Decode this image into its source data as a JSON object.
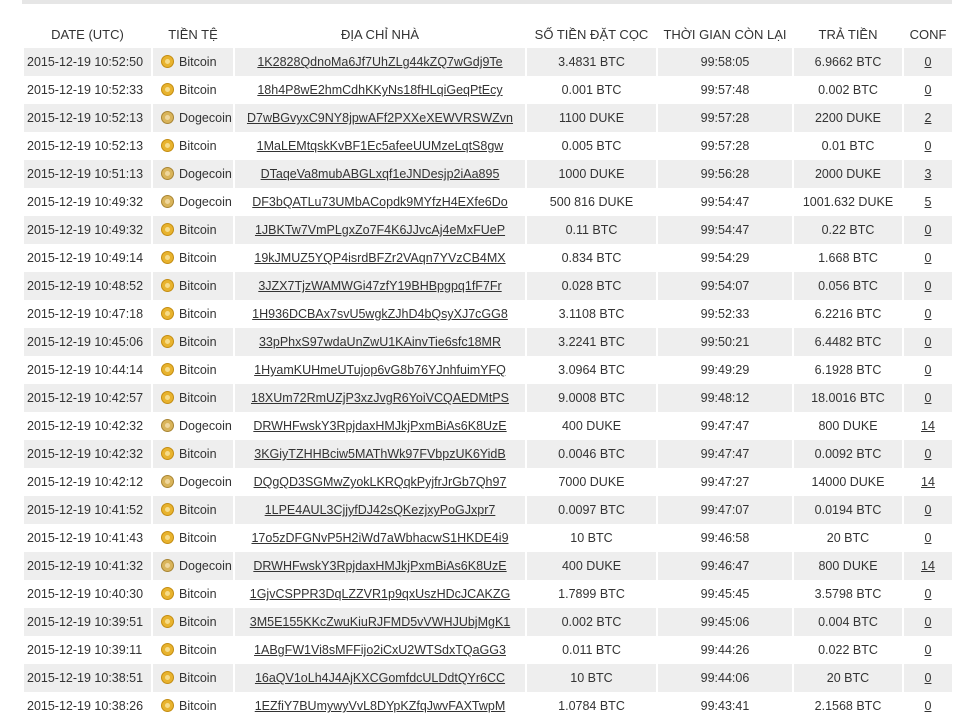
{
  "headers": {
    "date": "DATE (UTC)",
    "currency": "TIỀN TỆ",
    "address": "ĐỊA CHỈ NHÀ",
    "deposit": "SỐ TIỀN ĐẶT CỌC",
    "time_left": "THỜI GIAN CÒN LẠI",
    "payout": "TRẢ TIỀN",
    "conf": "CONF"
  },
  "icons": {
    "bitcoin": "bitcoin-coin-icon",
    "dogecoin": "dogecoin-coin-icon"
  },
  "rows": [
    {
      "date": "2015-12-19 10:52:50",
      "currency": "Bitcoin",
      "address": "1K2828QdnoMa6Jf7UhZLg44kZQ7wGdj9Te",
      "deposit": "3.4831 BTC",
      "time_left": "99:58:05",
      "payout": "6.9662 BTC",
      "conf": "0"
    },
    {
      "date": "2015-12-19 10:52:33",
      "currency": "Bitcoin",
      "address": "18h4P8wE2hmCdhKKyNs18fHLqiGeqPtEcy",
      "deposit": "0.001 BTC",
      "time_left": "99:57:48",
      "payout": "0.002 BTC",
      "conf": "0"
    },
    {
      "date": "2015-12-19 10:52:13",
      "currency": "Dogecoin",
      "address": "D7wBGvyxC9NY8jpwAFf2PXXeXEWVRSWZvn",
      "deposit": "1100 DUKE",
      "time_left": "99:57:28",
      "payout": "2200 DUKE",
      "conf": "2"
    },
    {
      "date": "2015-12-19 10:52:13",
      "currency": "Bitcoin",
      "address": "1MaLEMtqskKvBF1Ec5afeeUUMzeLqtS8gw",
      "deposit": "0.005 BTC",
      "time_left": "99:57:28",
      "payout": "0.01 BTC",
      "conf": "0"
    },
    {
      "date": "2015-12-19 10:51:13",
      "currency": "Dogecoin",
      "address": "DTaqeVa8mubABGLxqf1eJNDesjp2iAa895",
      "deposit": "1000 DUKE",
      "time_left": "99:56:28",
      "payout": "2000 DUKE",
      "conf": "3"
    },
    {
      "date": "2015-12-19 10:49:32",
      "currency": "Dogecoin",
      "address": "DF3bQATLu73UMbACopdk9MYfzH4EXfe6Do",
      "deposit": "500 816 DUKE",
      "time_left": "99:54:47",
      "payout": "1001.632 DUKE",
      "conf": "5"
    },
    {
      "date": "2015-12-19 10:49:32",
      "currency": "Bitcoin",
      "address": "1JBKTw7VmPLgxZo7F4K6JJvcAj4eMxFUeP",
      "deposit": "0.11 BTC",
      "time_left": "99:54:47",
      "payout": "0.22 BTC",
      "conf": "0"
    },
    {
      "date": "2015-12-19 10:49:14",
      "currency": "Bitcoin",
      "address": "19kJMUZ5YQP4isrdBFZr2VAqn7YVzCB4MX",
      "deposit": "0.834 BTC",
      "time_left": "99:54:29",
      "payout": "1.668 BTC",
      "conf": "0"
    },
    {
      "date": "2015-12-19 10:48:52",
      "currency": "Bitcoin",
      "address": "3JZX7TjzWAMWGi47zfY19BHBpgpq1fF7Fr",
      "deposit": "0.028 BTC",
      "time_left": "99:54:07",
      "payout": "0.056 BTC",
      "conf": "0"
    },
    {
      "date": "2015-12-19 10:47:18",
      "currency": "Bitcoin",
      "address": "1H936DCBAx7svU5wgkZJhD4bQsyXJ7cGG8",
      "deposit": "3.1108 BTC",
      "time_left": "99:52:33",
      "payout": "6.2216 BTC",
      "conf": "0"
    },
    {
      "date": "2015-12-19 10:45:06",
      "currency": "Bitcoin",
      "address": "33pPhxS97wdaUnZwU1KAinvTie6sfc18MR",
      "deposit": "3.2241 BTC",
      "time_left": "99:50:21",
      "payout": "6.4482 BTC",
      "conf": "0"
    },
    {
      "date": "2015-12-19 10:44:14",
      "currency": "Bitcoin",
      "address": "1HyamKUHmeUTujop6vG8b76YJnhfuimYFQ",
      "deposit": "3.0964 BTC",
      "time_left": "99:49:29",
      "payout": "6.1928 BTC",
      "conf": "0"
    },
    {
      "date": "2015-12-19 10:42:57",
      "currency": "Bitcoin",
      "address": "18XUm72RmUZjP3xzJvgR6YoiVCQAEDMtPS",
      "deposit": "9.0008 BTC",
      "time_left": "99:48:12",
      "payout": "18.0016 BTC",
      "conf": "0"
    },
    {
      "date": "2015-12-19 10:42:32",
      "currency": "Dogecoin",
      "address": "DRWHFwskY3RpjdaxHMJkjPxmBiAs6K8UzE",
      "deposit": "400 DUKE",
      "time_left": "99:47:47",
      "payout": "800 DUKE",
      "conf": "14"
    },
    {
      "date": "2015-12-19 10:42:32",
      "currency": "Bitcoin",
      "address": "3KGiyTZHHBciw5MAThWk97FVbpzUK6YidB",
      "deposit": "0.0046 BTC",
      "time_left": "99:47:47",
      "payout": "0.0092 BTC",
      "conf": "0"
    },
    {
      "date": "2015-12-19 10:42:12",
      "currency": "Dogecoin",
      "address": "DQgQD3SGMwZyokLKRQqkPyjfrJrGb7Qh97",
      "deposit": "7000 DUKE",
      "time_left": "99:47:27",
      "payout": "14000 DUKE",
      "conf": "14"
    },
    {
      "date": "2015-12-19 10:41:52",
      "currency": "Bitcoin",
      "address": "1LPE4AUL3CjjyfDJ42sQKezjxyPoGJxpr7",
      "deposit": "0.0097 BTC",
      "time_left": "99:47:07",
      "payout": "0.0194 BTC",
      "conf": "0"
    },
    {
      "date": "2015-12-19 10:41:43",
      "currency": "Bitcoin",
      "address": "17o5zDFGNvP5H2iWd7aWbhacwS1HKDE4i9",
      "deposit": "10 BTC",
      "time_left": "99:46:58",
      "payout": "20 BTC",
      "conf": "0"
    },
    {
      "date": "2015-12-19 10:41:32",
      "currency": "Dogecoin",
      "address": "DRWHFwskY3RpjdaxHMJkjPxmBiAs6K8UzE",
      "deposit": "400 DUKE",
      "time_left": "99:46:47",
      "payout": "800 DUKE",
      "conf": "14"
    },
    {
      "date": "2015-12-19 10:40:30",
      "currency": "Bitcoin",
      "address": "1GjvCSPPR3DqLZZVR1p9qxUszHDcJCAKZG",
      "deposit": "1.7899 BTC",
      "time_left": "99:45:45",
      "payout": "3.5798 BTC",
      "conf": "0"
    },
    {
      "date": "2015-12-19 10:39:51",
      "currency": "Bitcoin",
      "address": "3M5E155KKcZwuKiuRJFMD5vVWHJUbjMgK1",
      "deposit": "0.002 BTC",
      "time_left": "99:45:06",
      "payout": "0.004 BTC",
      "conf": "0"
    },
    {
      "date": "2015-12-19 10:39:11",
      "currency": "Bitcoin",
      "address": "1ABgFW1Vi8sMFFijo2iCxU2WTSdxTQaGG3",
      "deposit": "0.011 BTC",
      "time_left": "99:44:26",
      "payout": "0.022 BTC",
      "conf": "0"
    },
    {
      "date": "2015-12-19 10:38:51",
      "currency": "Bitcoin",
      "address": "16aQV1oLh4J4AjKXCGomfdcULDdtQYr6CC",
      "deposit": "10 BTC",
      "time_left": "99:44:06",
      "payout": "20 BTC",
      "conf": "0"
    },
    {
      "date": "2015-12-19 10:38:26",
      "currency": "Bitcoin",
      "address": "1EZfiY7BUmywyVvL8DYpKZfqJwvFAXTwpM",
      "deposit": "1.0784 BTC",
      "time_left": "99:43:41",
      "payout": "2.1568 BTC",
      "conf": "0"
    }
  ]
}
